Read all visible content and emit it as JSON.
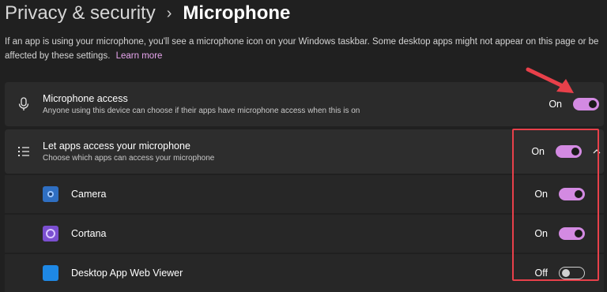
{
  "breadcrumb": {
    "parent": "Privacy & security",
    "separator": "›",
    "current": "Microphone"
  },
  "description": {
    "text": "If an app is using your microphone, you'll see a microphone icon on your Windows taskbar. Some desktop apps might not appear on this page or be affected by these settings.",
    "link": "Learn more"
  },
  "microphone_access": {
    "icon": "microphone-icon",
    "title": "Microphone access",
    "subtitle": "Anyone using this device can choose if their apps have microphone access when this is on",
    "state_label": "On",
    "on": true
  },
  "apps_access": {
    "icon": "list-icon",
    "title": "Let apps access your microphone",
    "subtitle": "Choose which apps can access your microphone",
    "state_label": "On",
    "on": true,
    "expanded": true
  },
  "apps": [
    {
      "name": "Camera",
      "icon": "camera-app-icon",
      "icon_color": "#3a7bd5",
      "state_label": "On",
      "on": true
    },
    {
      "name": "Cortana",
      "icon": "cortana-app-icon",
      "icon_color": "#7b4fd0",
      "state_label": "On",
      "on": true
    },
    {
      "name": "Desktop App Web Viewer",
      "icon": "web-viewer-app-icon",
      "icon_color": "#1e88e5",
      "state_label": "Off",
      "on": false
    }
  ],
  "colors": {
    "accent": "#d38ae2",
    "background": "#202020",
    "card": "#2b2b2b",
    "annotation": "#e8404a"
  }
}
